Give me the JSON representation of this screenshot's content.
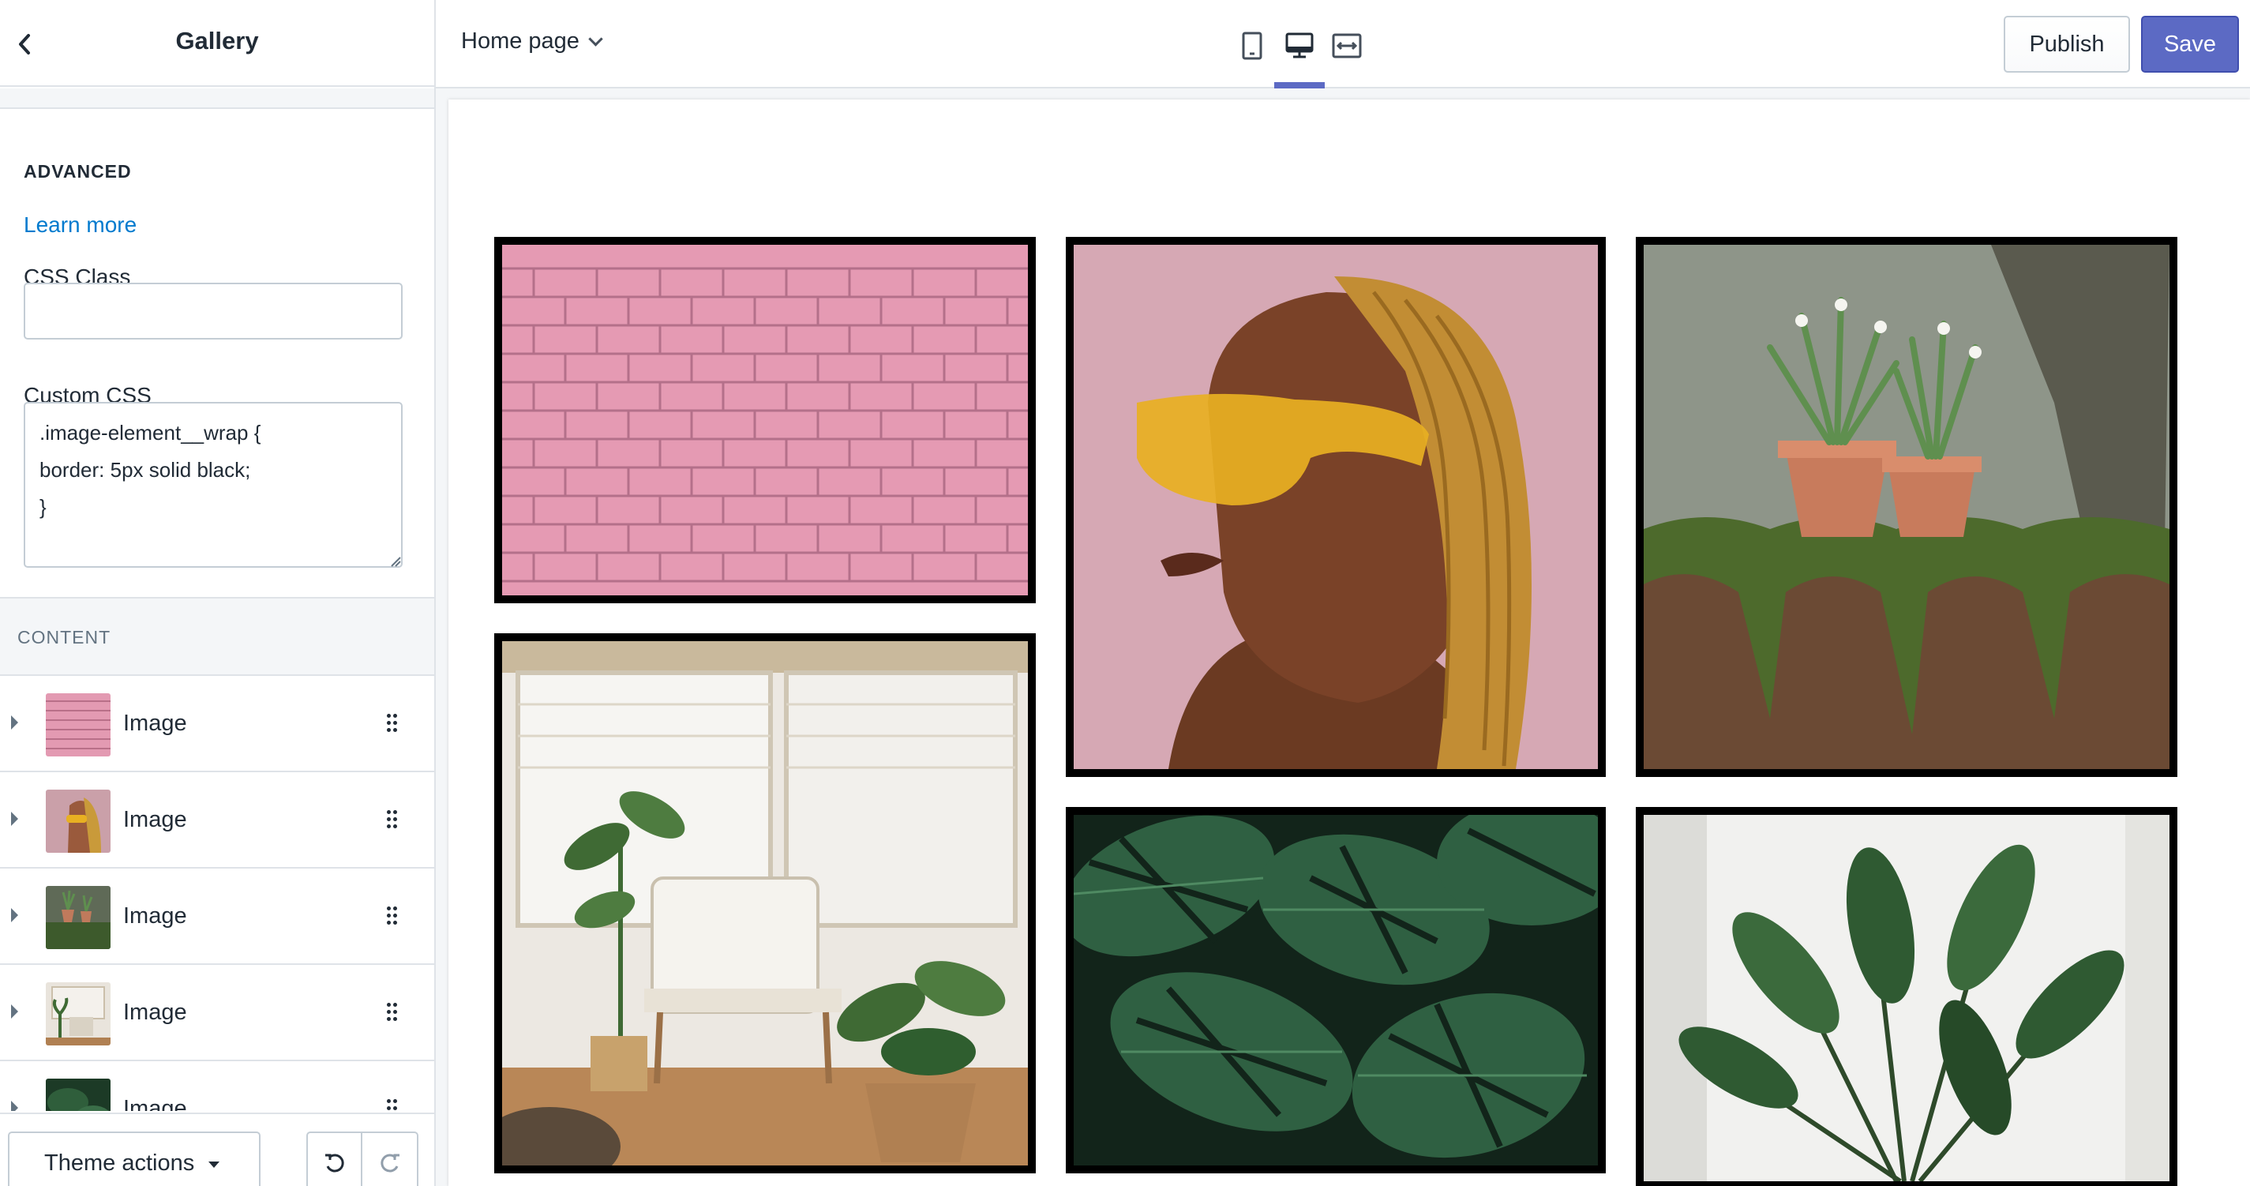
{
  "sidebar": {
    "title": "Gallery",
    "advanced": {
      "heading": "ADVANCED",
      "learn_more": "Learn more",
      "css_class_label": "CSS Class",
      "css_class_value": "",
      "custom_css_label": "Custom CSS",
      "custom_css_value": ".image-element__wrap {\nborder: 5px solid black;\n}"
    },
    "content": {
      "heading": "CONTENT",
      "items": [
        {
          "label": "Image",
          "thumb": "pink-brick-wall"
        },
        {
          "label": "Image",
          "thumb": "woman-yellow-sunglasses"
        },
        {
          "label": "Image",
          "thumb": "potted-plants-moss"
        },
        {
          "label": "Image",
          "thumb": "room-chair-plants"
        },
        {
          "label": "Image",
          "thumb": "monstera-leaves"
        }
      ]
    },
    "footer": {
      "theme_actions": "Theme actions"
    }
  },
  "topbar": {
    "page_select": "Home page",
    "viewports": [
      "mobile-icon",
      "desktop-icon",
      "full-width-icon"
    ],
    "active_viewport": "desktop",
    "publish": "Publish",
    "save": "Save"
  },
  "colors": {
    "accent": "#5c6ac4",
    "link": "#007ace",
    "border": "#dfe3e8"
  },
  "gallery": {
    "images": [
      "pink-brick-wall",
      "woman-yellow-sunglasses",
      "potted-plants-moss",
      "room-chair-plants",
      "monstera-leaves",
      "bird-of-paradise-plant"
    ]
  }
}
